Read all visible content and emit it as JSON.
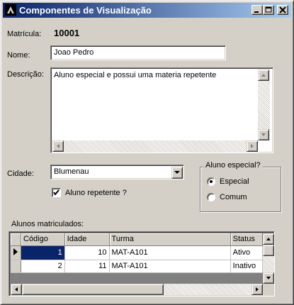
{
  "window": {
    "title": "Componentes de Visualização"
  },
  "form": {
    "matricula_label": "Matrícula:",
    "matricula_value": "10001",
    "nome_label": "Nome:",
    "nome_value": "Joao Pedro",
    "descricao_label": "Descrição:",
    "descricao_value": "Aluno especial e possui uma materia repetente",
    "cidade_label": "Cidade:",
    "cidade_value": "Blumenau",
    "repetente_label": "Aluno repetente ?",
    "repetente_checked": true
  },
  "especial_group": {
    "title": "Aluno especial?",
    "options": [
      {
        "label": "Especial",
        "selected": true
      },
      {
        "label": "Comum",
        "selected": false
      }
    ]
  },
  "grid": {
    "caption": "Alunos matriculados:",
    "columns": [
      "Código",
      "Idade",
      "Turma",
      "Status"
    ],
    "rows": [
      {
        "codigo": "1",
        "idade": "10",
        "turma": "MAT-A101",
        "status": "Ativo"
      },
      {
        "codigo": "2",
        "idade": "11",
        "turma": "MAT-A101",
        "status": "Inativo"
      }
    ]
  }
}
